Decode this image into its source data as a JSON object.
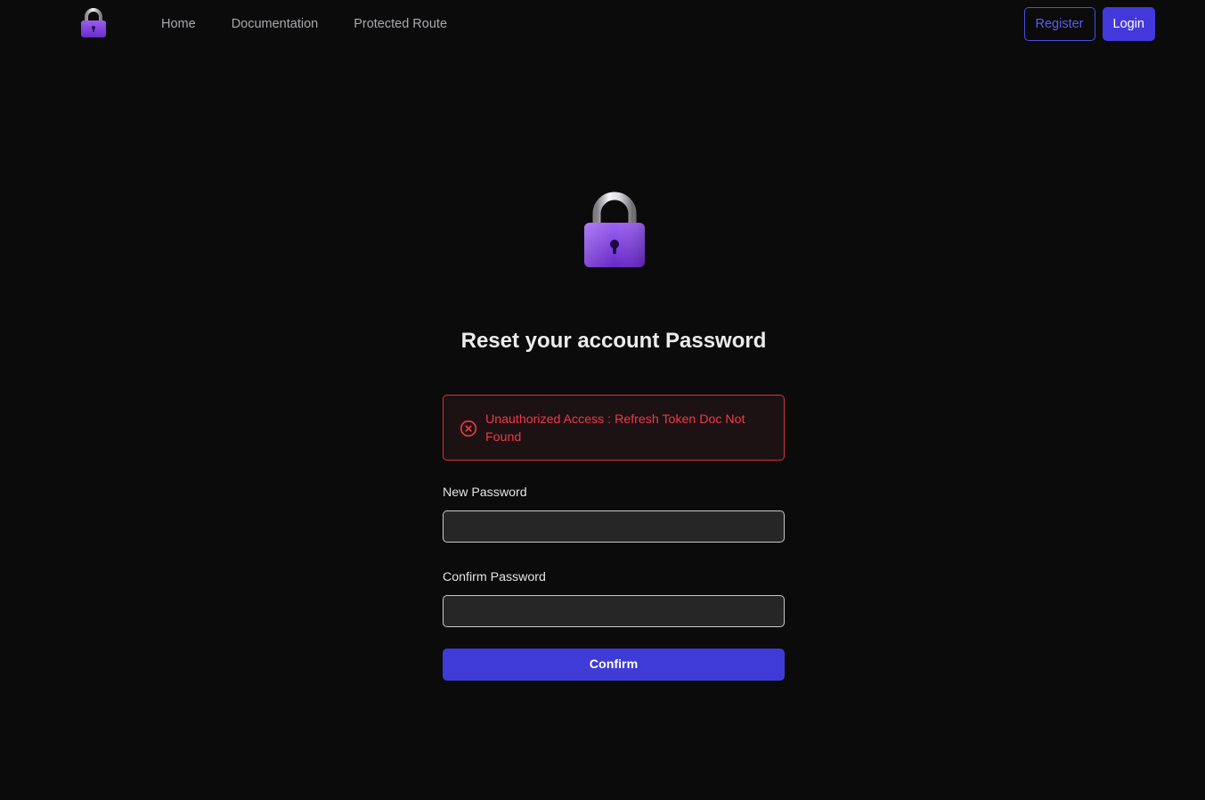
{
  "nav": {
    "logo_icon": "lock-icon",
    "links": [
      {
        "label": "Home"
      },
      {
        "label": "Documentation"
      },
      {
        "label": "Protected Route"
      }
    ],
    "register_label": "Register",
    "login_label": "Login"
  },
  "main": {
    "hero_icon": "lock-icon",
    "title": "Reset your account Password",
    "alert": {
      "icon": "x-circle-icon",
      "message": "Unauthorized Access : Refresh Token Doc Not Found",
      "color": "#f03a45"
    },
    "new_password": {
      "label": "New Password",
      "value": "",
      "placeholder": ""
    },
    "confirm_password": {
      "label": "Confirm Password",
      "value": "",
      "placeholder": ""
    },
    "confirm_label": "Confirm"
  },
  "colors": {
    "background": "#0b0b0c",
    "accent": "#4338dc",
    "error": "#d4303b",
    "lock_body": "#7b3fd6"
  }
}
